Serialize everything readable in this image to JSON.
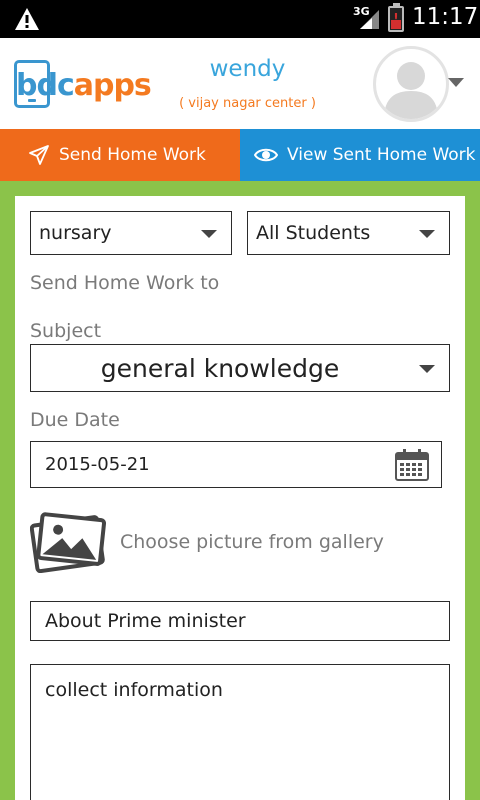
{
  "status_bar": {
    "network": "3G",
    "time": "11:17"
  },
  "header": {
    "logo": {
      "part1": "bdc",
      "part2": "apps"
    },
    "user_name": "wendy",
    "center": "( vijay nagar center )"
  },
  "tabs": [
    {
      "label": "Send Home Work",
      "icon": "paper-plane-icon",
      "active": true
    },
    {
      "label": "View Sent Home Work",
      "icon": "eye-icon",
      "active": false
    }
  ],
  "form": {
    "class_select": "nursary",
    "students_select": "All Students",
    "send_to_label": "Send Home Work to",
    "subject_label": "Subject",
    "subject_value": "general knowledge",
    "due_date_label": "Due Date",
    "due_date_value": "2015-05-21",
    "gallery_label": "Choose picture from gallery",
    "title_value": "About Prime minister",
    "description_value": "collect information"
  },
  "colors": {
    "background": "#8bc34a",
    "tab_send": "#ef6a1b",
    "tab_view": "#1e90d5",
    "user_name": "#39a5dc",
    "center": "#f47a20"
  }
}
